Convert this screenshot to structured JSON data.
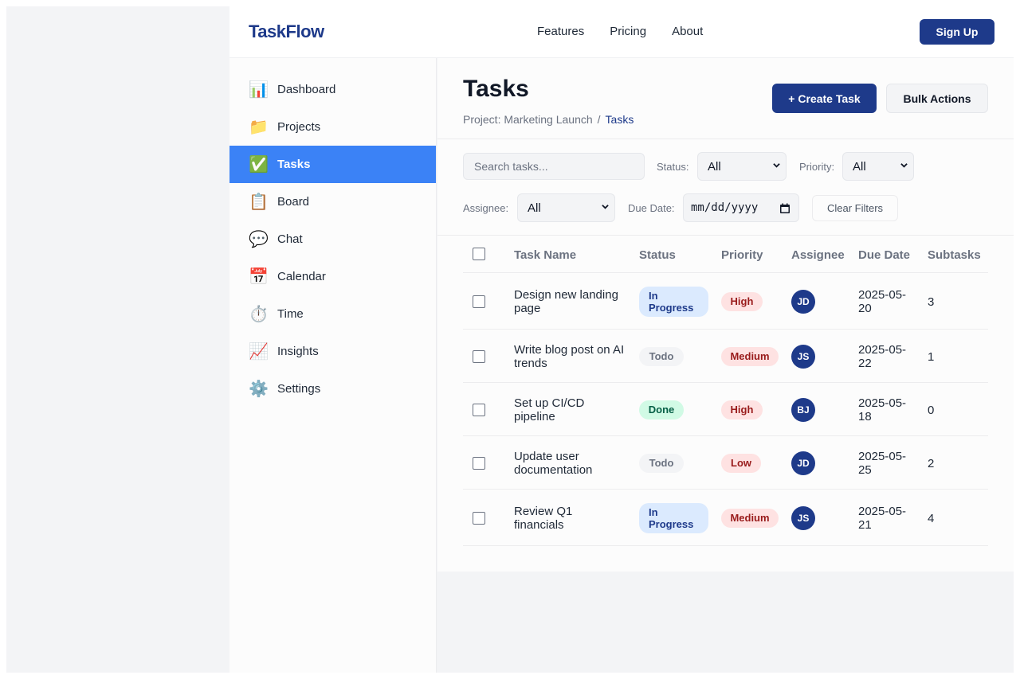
{
  "app": {
    "logo": "TaskFlow"
  },
  "topnav": {
    "links": [
      "Features",
      "Pricing",
      "About"
    ],
    "signup_label": "Sign Up"
  },
  "sidebar": {
    "items": [
      {
        "icon": "📊",
        "icon_name": "chart-icon",
        "label": "Dashboard"
      },
      {
        "icon": "📁",
        "icon_name": "folder-icon",
        "label": "Projects"
      },
      {
        "icon": "✅",
        "icon_name": "check-icon",
        "label": "Tasks",
        "active": true
      },
      {
        "icon": "📋",
        "icon_name": "clipboard-icon",
        "label": "Board"
      },
      {
        "icon": "💬",
        "icon_name": "chat-bubble-icon",
        "label": "Chat"
      },
      {
        "icon": "📅",
        "icon_name": "calendar-icon",
        "label": "Calendar"
      },
      {
        "icon": "⏱️",
        "icon_name": "stopwatch-icon",
        "label": "Time"
      },
      {
        "icon": "📈",
        "icon_name": "trend-chart-icon",
        "label": "Insights"
      },
      {
        "icon": "⚙️",
        "icon_name": "gear-icon",
        "label": "Settings"
      }
    ]
  },
  "page": {
    "title": "Tasks",
    "breadcrumb": {
      "parent": "Project: Marketing Launch",
      "separator": "/",
      "current": "Tasks"
    },
    "create_label": "+ Create Task",
    "bulk_label": "Bulk Actions"
  },
  "filters": {
    "search_placeholder": "Search tasks...",
    "status_label": "Status:",
    "status_value": "All",
    "priority_label": "Priority:",
    "priority_value": "All",
    "assignee_label": "Assignee:",
    "assignee_value": "All",
    "due_label": "Due Date:",
    "due_placeholder": "mm/dd/yyyy",
    "clear_label": "Clear Filters"
  },
  "table": {
    "headers": [
      "Task Name",
      "Status",
      "Priority",
      "Assignee",
      "Due Date",
      "Subtasks"
    ],
    "rows": [
      {
        "name_l1": "Design new landing",
        "name_l2": "page",
        "status_l1": "In",
        "status_l2": "Progress",
        "status_kind": "progress",
        "priority": "High",
        "priority_kind": "high",
        "assignee": "JD",
        "due_l1": "2025-05-",
        "due_l2": "20",
        "subtasks": "3"
      },
      {
        "name_l1": "Write blog post on AI",
        "name_l2": "trends",
        "status_l1": "Todo",
        "status_l2": "",
        "status_kind": "todo",
        "priority": "Medium",
        "priority_kind": "medium",
        "assignee": "JS",
        "due_l1": "2025-05-",
        "due_l2": "22",
        "subtasks": "1"
      },
      {
        "name_l1": "Set up CI/CD",
        "name_l2": "pipeline",
        "status_l1": "Done",
        "status_l2": "",
        "status_kind": "done",
        "priority": "High",
        "priority_kind": "high",
        "assignee": "BJ",
        "due_l1": "2025-05-",
        "due_l2": "18",
        "subtasks": "0"
      },
      {
        "name_l1": "Update user",
        "name_l2": "documentation",
        "status_l1": "Todo",
        "status_l2": "",
        "status_kind": "todo",
        "priority": "Low",
        "priority_kind": "low",
        "assignee": "JD",
        "due_l1": "2025-05-",
        "due_l2": "25",
        "subtasks": "2"
      },
      {
        "name_l1": "Review Q1",
        "name_l2": "financials",
        "status_l1": "In",
        "status_l2": "Progress",
        "status_kind": "progress",
        "priority": "Medium",
        "priority_kind": "medium",
        "assignee": "JS",
        "due_l1": "2025-05-",
        "due_l2": "21",
        "subtasks": "4"
      }
    ]
  },
  "colors": {
    "brand": "#1e3a8a",
    "active_nav": "#3b82f6",
    "status_progress_bg": "#dbeafe",
    "status_progress_fg": "#1e3a8a",
    "status_todo_bg": "#f3f4f6",
    "status_todo_fg": "#6b7280",
    "status_done_bg": "#d1fae5",
    "status_done_fg": "#065f46",
    "priority_bg": "#fee2e2",
    "priority_fg": "#991b1b"
  }
}
